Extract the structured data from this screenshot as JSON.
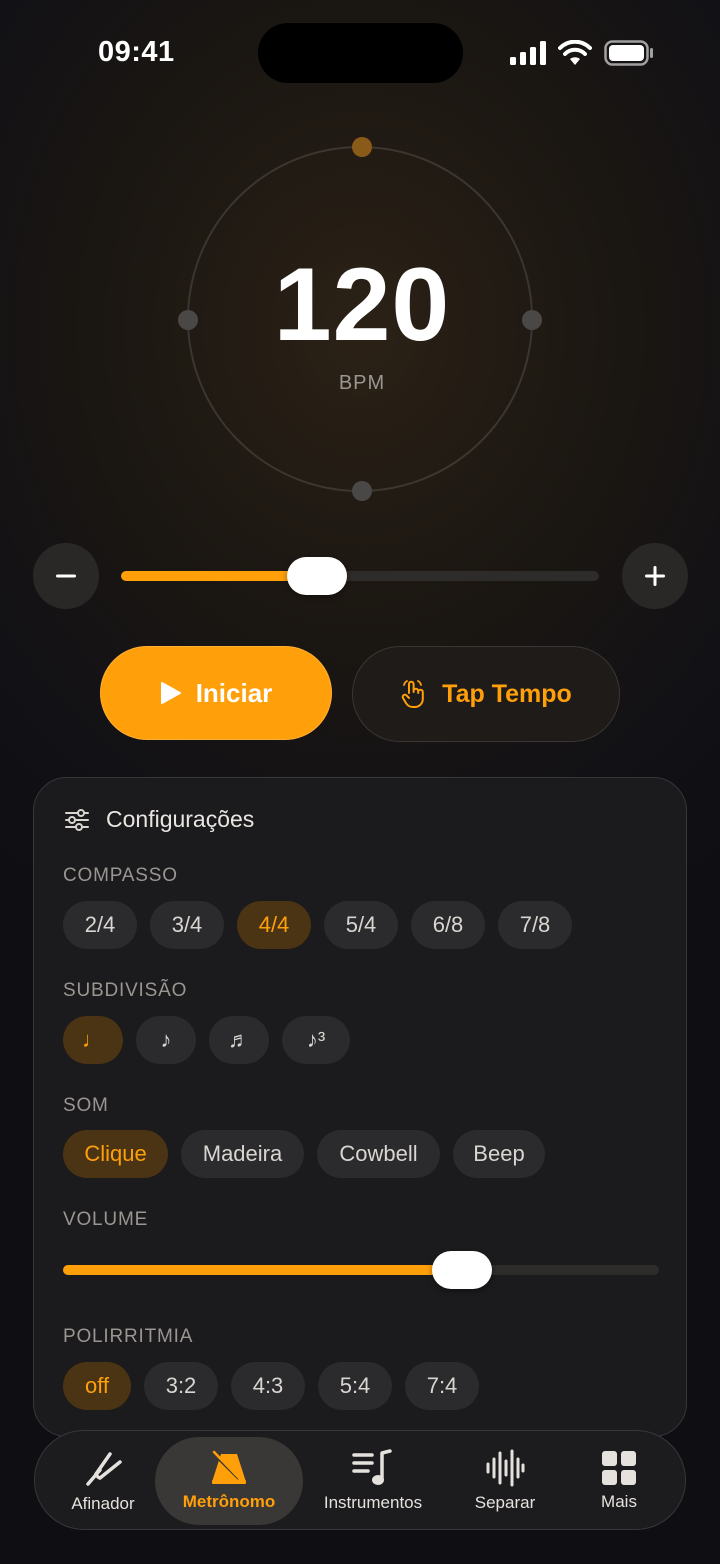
{
  "status": {
    "time": "09:41"
  },
  "tempo": {
    "value": "120",
    "unit": "BPM",
    "slider_fraction": 0.41
  },
  "buttons": {
    "start": "Iniciar",
    "tap": "Tap Tempo"
  },
  "settings": {
    "title": "Configurações",
    "time_signature": {
      "label": "COMPASSO",
      "options": [
        "2/4",
        "3/4",
        "4/4",
        "5/4",
        "6/8",
        "7/8"
      ],
      "selected": "4/4"
    },
    "subdivision": {
      "label": "SUBDIVISÃO",
      "options": [
        "♩",
        "♪",
        "♬",
        "♪³"
      ],
      "selected": "♩"
    },
    "sound": {
      "label": "SOM",
      "options": [
        "Clique",
        "Madeira",
        "Cowbell",
        "Beep"
      ],
      "selected": "Clique"
    },
    "volume": {
      "label": "VOLUME",
      "fraction": 0.67
    },
    "polyrhythm": {
      "label": "POLIRRITMIA",
      "options": [
        "off",
        "3:2",
        "4:3",
        "5:4",
        "7:4"
      ],
      "selected": "off"
    }
  },
  "tabs": [
    {
      "label": "Afinador",
      "icon": "tuning-fork-icon"
    },
    {
      "label": "Metrônomo",
      "icon": "metronome-icon",
      "active": true
    },
    {
      "label": "Instrumentos",
      "icon": "music-list-icon"
    },
    {
      "label": "Separar",
      "icon": "waveform-icon"
    },
    {
      "label": "Mais",
      "icon": "grid-icon"
    }
  ],
  "colors": {
    "accent": "#ff9f0a",
    "card": "#1b1a1c",
    "chip": "#2b2a2c",
    "chip_active": "#4a3414"
  }
}
